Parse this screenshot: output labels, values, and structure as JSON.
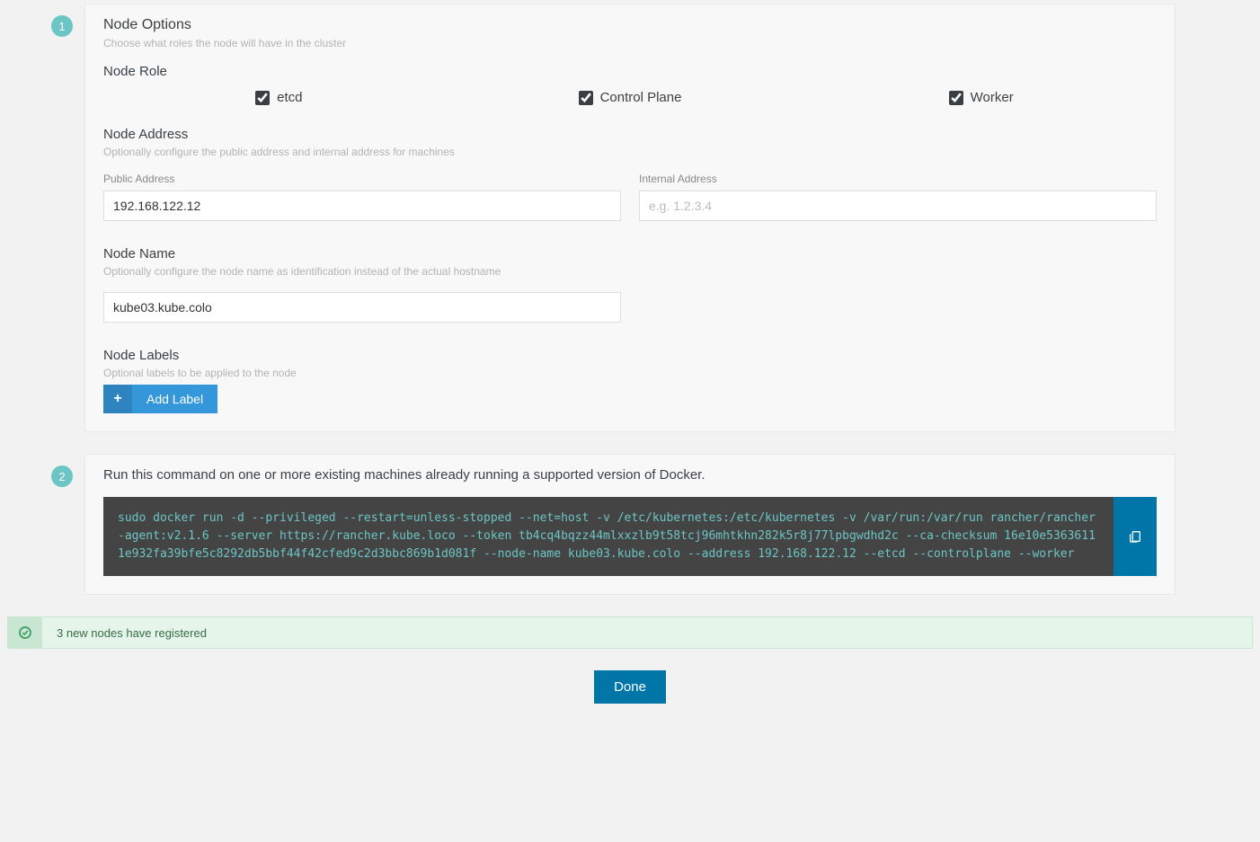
{
  "step1": {
    "badge": "1",
    "title": "Node Options",
    "desc": "Choose what roles the node will have in the cluster",
    "role": {
      "title": "Node Role",
      "etcd": "etcd",
      "controlplane": "Control Plane",
      "worker": "Worker"
    },
    "address": {
      "title": "Node Address",
      "desc": "Optionally configure the public address and internal address for machines",
      "public_label": "Public Address",
      "public_value": "192.168.122.12",
      "internal_label": "Internal Address",
      "internal_placeholder": "e.g. 1.2.3.4"
    },
    "name": {
      "title": "Node Name",
      "desc": "Optionally configure the node name as identification instead of the actual hostname",
      "value": "kube03.kube.colo"
    },
    "labels": {
      "title": "Node Labels",
      "desc": "Optional labels to be applied to the node",
      "add_button": "Add Label"
    }
  },
  "step2": {
    "badge": "2",
    "desc": "Run this command on one or more existing machines already running a supported version of Docker.",
    "command": "sudo docker run -d --privileged --restart=unless-stopped --net=host -v /etc/kubernetes:/etc/kubernetes -v /var/run:/var/run rancher/rancher-agent:v2.1.6 --server https://rancher.kube.loco --token tb4cq4bqzz44mlxxzlb9t58tcj96mhtkhn282k5r8j77lpbgwdhd2c --ca-checksum 16e10e53636111e932fa39bfe5c8292db5bbf44f42cfed9c2d3bbc869b1d081f --node-name kube03.kube.colo --address 192.168.122.12 --etcd --controlplane --worker"
  },
  "alert": {
    "text": "3 new nodes have registered"
  },
  "done_button": "Done"
}
